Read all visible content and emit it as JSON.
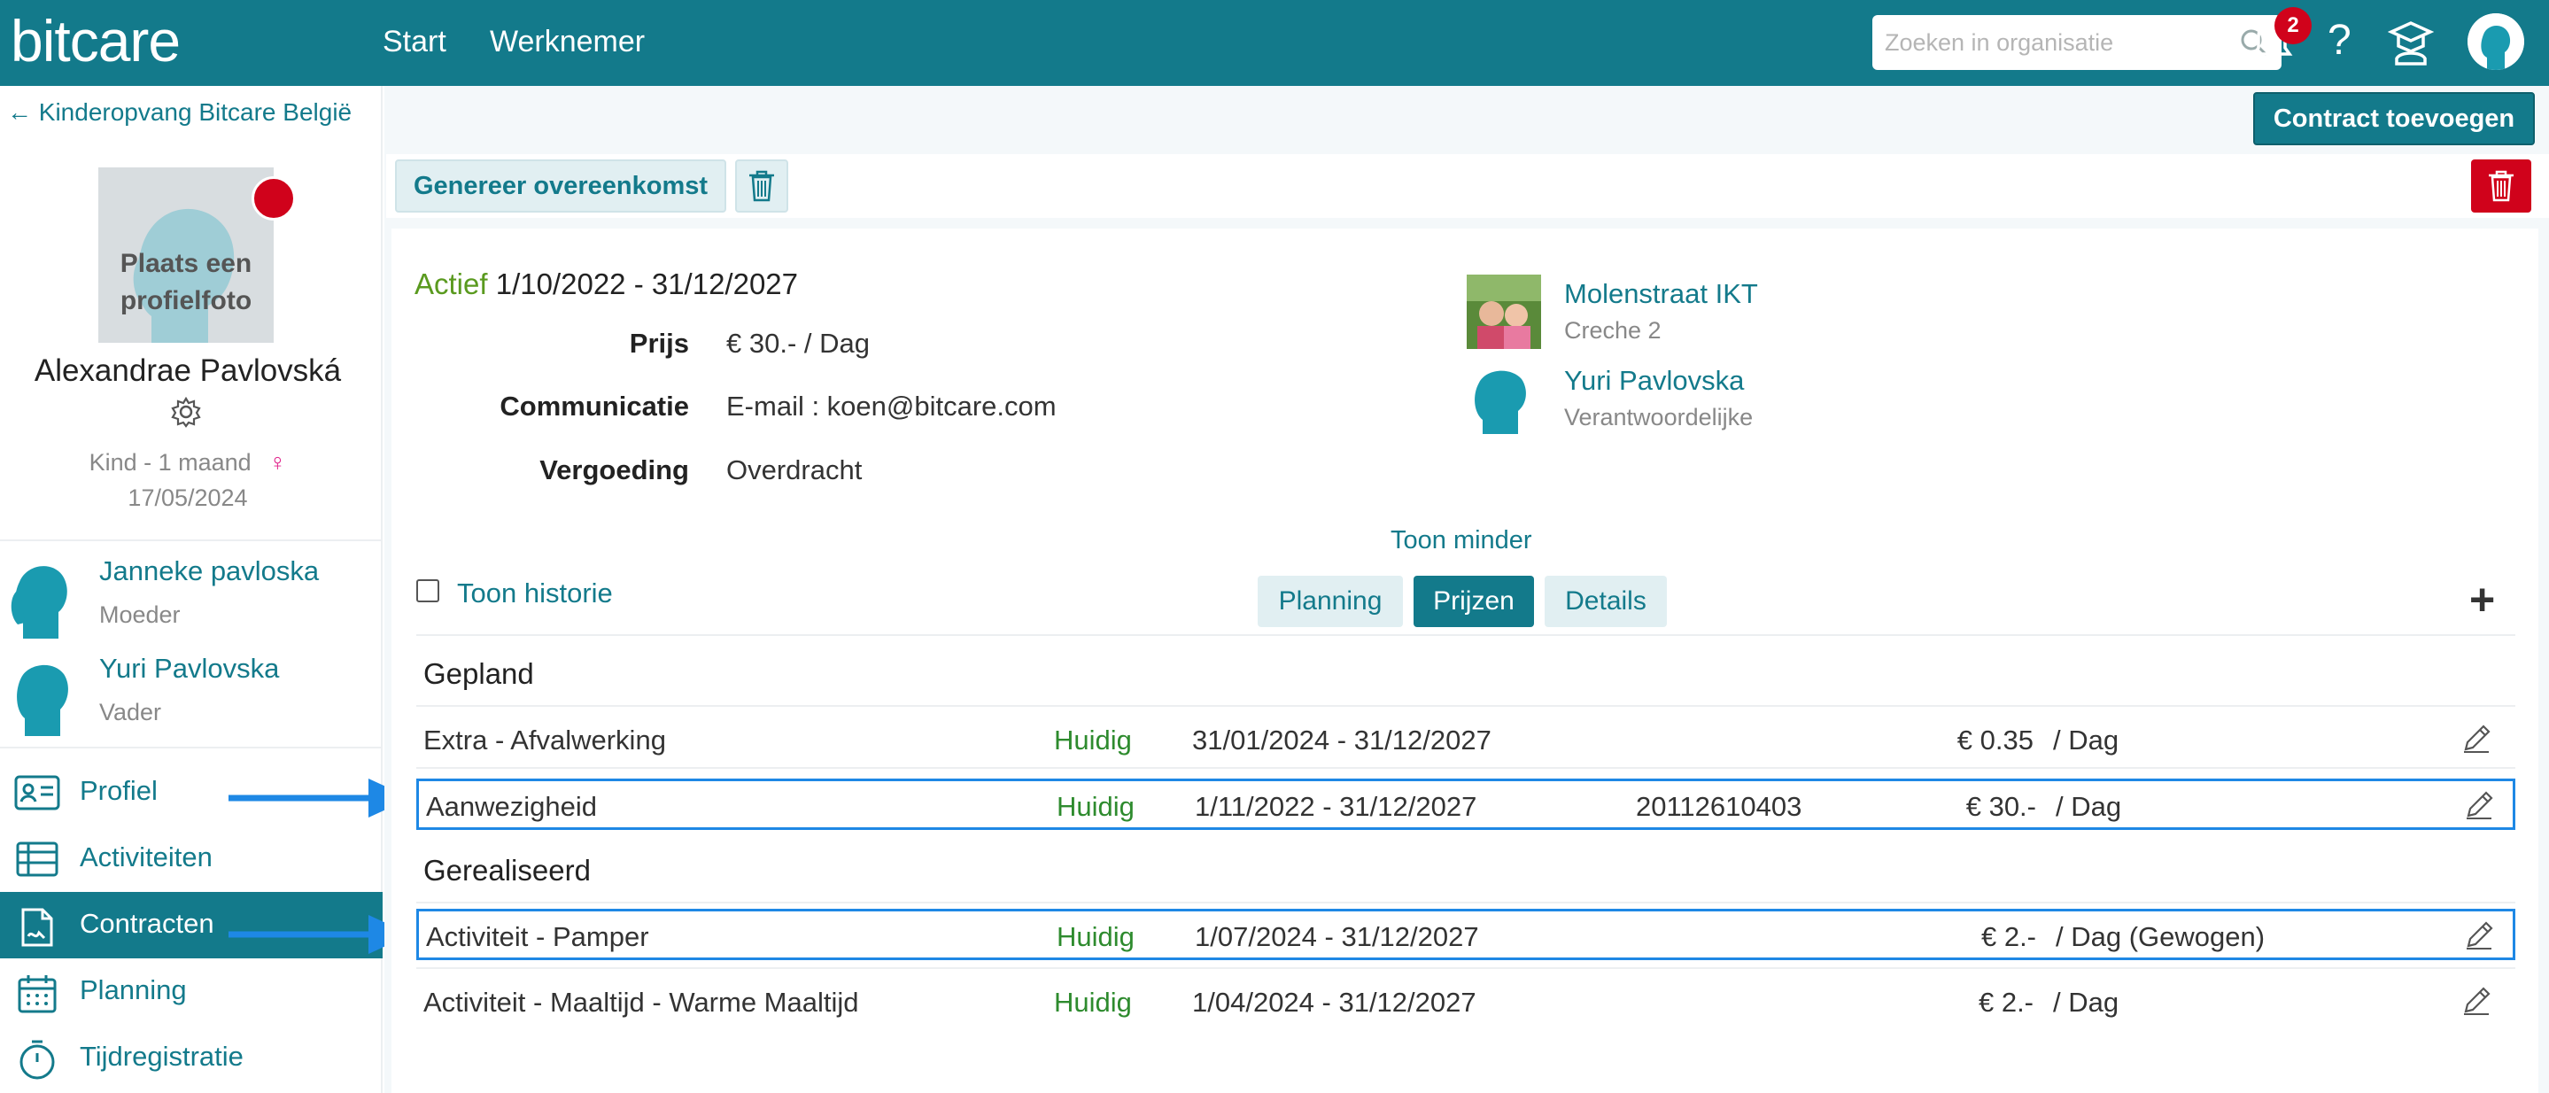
{
  "topbar": {
    "logo": "bitcare",
    "nav": [
      "Start",
      "Werknemer"
    ],
    "search_placeholder": "Zoeken in organisatie",
    "notification_count": "2",
    "help_label": "?"
  },
  "sidebar": {
    "back_label": "Kinderopvang Bitcare België",
    "photo_text": "Plaats een profielfoto",
    "person_name": "Alexandrae Pavlovská",
    "kind_line": "Kind - 1 maand",
    "gender_symbol": "♀",
    "birth_date": "17/05/2024",
    "parents": [
      {
        "name": "Janneke pavloska",
        "role": "Moeder"
      },
      {
        "name": "Yuri Pavlovska",
        "role": "Vader"
      }
    ],
    "menu": [
      {
        "label": "Profiel",
        "icon": "profile-card-icon"
      },
      {
        "label": "Activiteiten",
        "icon": "table-icon"
      },
      {
        "label": "Contracten",
        "icon": "contract-icon"
      },
      {
        "label": "Planning",
        "icon": "calendar-icon"
      },
      {
        "label": "Tijdregistratie",
        "icon": "stopwatch-icon"
      }
    ],
    "active_menu": "Contracten"
  },
  "toolbar": {
    "add_contract": "Contract toevoegen",
    "generate": "Genereer overeenkomst"
  },
  "contract": {
    "status": "Actief",
    "period": "1/10/2022 - 31/12/2027",
    "fields": [
      {
        "label": "Prijs",
        "value": "€ 30.- / Dag"
      },
      {
        "label": "Communicatie",
        "value": "E-mail : koen@bitcare.com"
      },
      {
        "label": "Vergoeding",
        "value": "Overdracht"
      }
    ],
    "locations": [
      {
        "title": "Molenstraat IKT",
        "sub": "Creche 2"
      },
      {
        "title": "Yuri Pavlovska",
        "sub": "Verantwoordelijke"
      }
    ],
    "show_less": "Toon minder",
    "show_history": "Toon historie",
    "tabs": [
      "Planning",
      "Prijzen",
      "Details"
    ],
    "active_tab": "Prijzen"
  },
  "prices": {
    "planned_heading": "Gepland",
    "realized_heading": "Gerealiseerd",
    "planned": [
      {
        "name": "Extra - Afvalwerking",
        "status": "Huidig",
        "period": "31/01/2024 - 31/12/2027",
        "code": "",
        "price": "€ 0.35",
        "unit": "/ Dag"
      },
      {
        "name": "Aanwezigheid",
        "status": "Huidig",
        "period": "1/11/2022 - 31/12/2027",
        "code": "20112610403",
        "price": "€ 30.-",
        "unit": "/ Dag"
      }
    ],
    "realized": [
      {
        "name": "Activiteit - Pamper",
        "status": "Huidig",
        "period": "1/07/2024 - 31/12/2027",
        "code": "",
        "price": "€ 2.-",
        "unit": "/ Dag (Gewogen)"
      },
      {
        "name": "Activiteit - Maaltijd - Warme Maaltijd",
        "status": "Huidig",
        "period": "1/04/2024 - 31/12/2027",
        "code": "",
        "price": "€ 2.-",
        "unit": "/ Dag"
      }
    ]
  },
  "colors": {
    "brand": "#137a8b",
    "status_active": "#5a9a1f",
    "status_current": "#2e8b2e",
    "danger": "#d0021b",
    "highlight": "#1e88e5"
  }
}
